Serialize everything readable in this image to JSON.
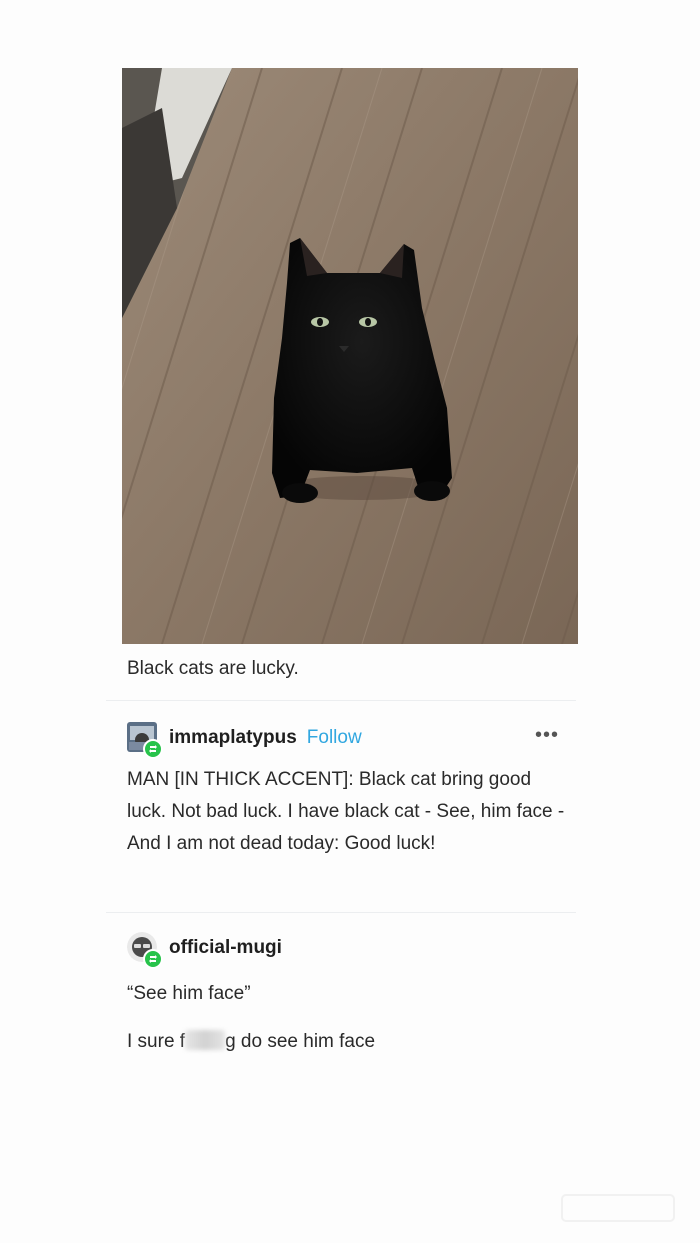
{
  "post": {
    "caption": "Black cats are lucky."
  },
  "reblogs": [
    {
      "username": "immaplatypus",
      "follow_label": "Follow",
      "more_label": "•••",
      "text": "MAN [IN THICK ACCENT]: Black cat bring good luck.  Not bad luck.  I have black cat - See, him face - And I am not dead today: Good luck!"
    },
    {
      "username": "official-mugi",
      "quote": "“See him face”",
      "line_prefix": "I sure f",
      "line_suffix": "g do see him face"
    }
  ],
  "icons": {
    "photo": "black-cat-photo",
    "avatar_1": "platypus-avatar-icon",
    "avatar_2": "mugi-avatar-icon",
    "reblog_badge": "reblog-icon",
    "more": "more-options-icon"
  },
  "colors": {
    "follow": "#31a7e0",
    "reblog_badge": "#27c34a",
    "text": "#1f1f1f"
  }
}
